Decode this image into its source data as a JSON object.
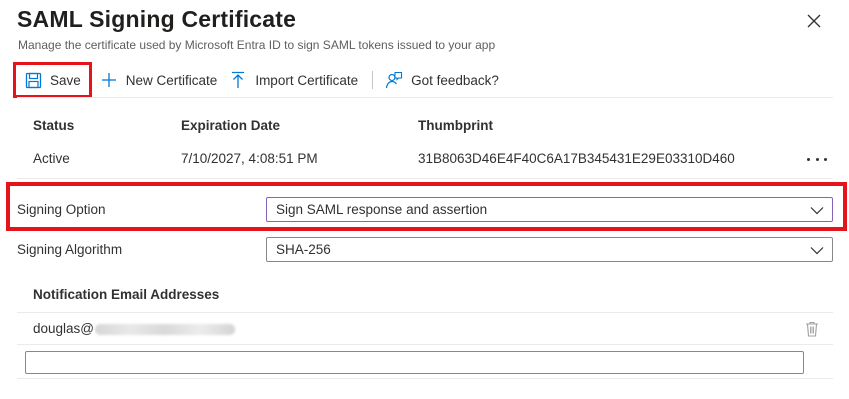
{
  "panel": {
    "title": "SAML Signing Certificate",
    "subtitle": "Manage the certificate used by Microsoft Entra ID to sign SAML tokens issued to your app"
  },
  "toolbar": {
    "save_label": "Save",
    "new_cert_label": "New Certificate",
    "import_cert_label": "Import Certificate",
    "feedback_label": "Got feedback?"
  },
  "certificates": {
    "headers": [
      "Status",
      "Expiration Date",
      "Thumbprint"
    ],
    "rows": [
      {
        "status": "Active",
        "expiration": "7/10/2027, 4:08:51 PM",
        "thumbprint": "31B8063D46E4F40C6A17B345431E29E03310D460"
      }
    ]
  },
  "signing_option": {
    "label": "Signing Option",
    "value": "Sign SAML response and assertion"
  },
  "signing_algorithm": {
    "label": "Signing Algorithm",
    "value": "SHA-256"
  },
  "notification": {
    "title": "Notification Email Addresses",
    "emails": [
      "douglas@"
    ],
    "new_email_value": ""
  },
  "colors": {
    "highlight": "#e5141a",
    "accent": "#0078d4",
    "active_border": "#8764b8"
  },
  "icons": {
    "save": "save-icon",
    "new": "plus-icon",
    "import": "upload-arrow-icon",
    "feedback": "feedback-person-icon",
    "close": "close-icon",
    "more": "more-options-icon",
    "chevron": "chevron-down-icon",
    "trash": "trash-icon"
  }
}
